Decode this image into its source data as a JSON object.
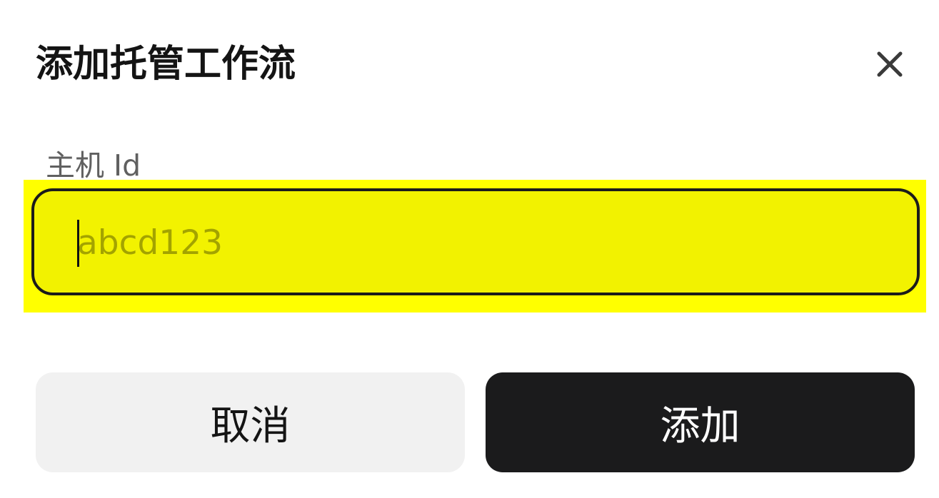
{
  "dialog": {
    "title": "添加托管工作流",
    "close_icon": "close-icon"
  },
  "form": {
    "host_id_label": "主机 Id",
    "host_id_placeholder": "abcd123",
    "host_id_value": ""
  },
  "actions": {
    "cancel_label": "取消",
    "add_label": "添加"
  },
  "colors": {
    "highlight": "#ffff00",
    "input_background": "#f2f200",
    "input_border": "#1b1b1b",
    "primary_button": "#1b1b1c",
    "secondary_button": "#f1f1f1"
  }
}
